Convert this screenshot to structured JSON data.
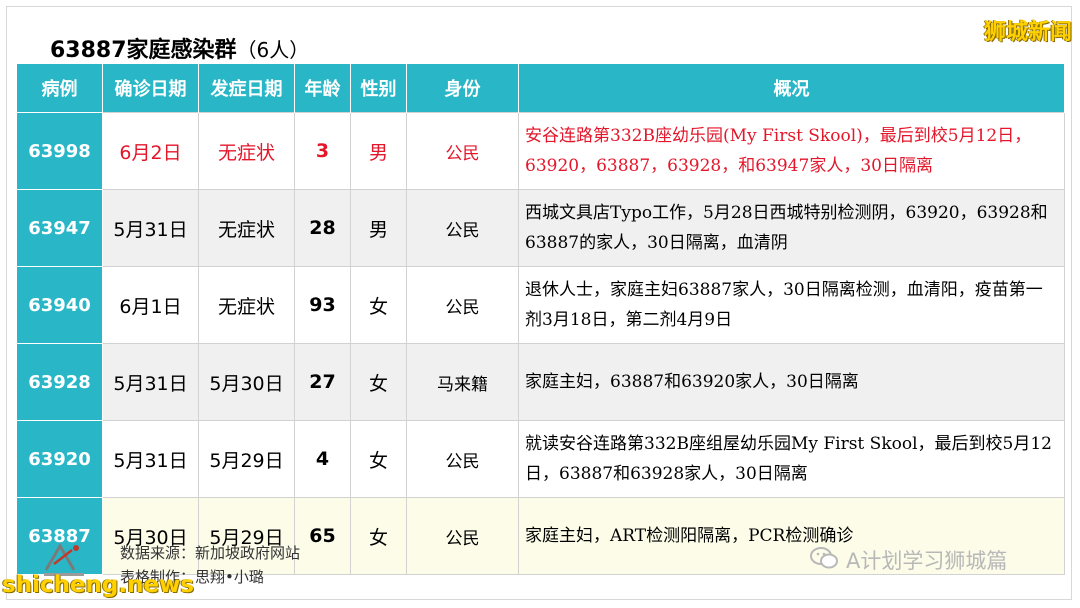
{
  "brand": "狮城新闻",
  "title": {
    "main": "63887家庭感染群",
    "count": "（6人）"
  },
  "table": {
    "headers": [
      "病例",
      "确诊日期",
      "发症日期",
      "年龄",
      "性别",
      "身份",
      "概况"
    ],
    "rows": [
      {
        "case": "63998",
        "confirmed": "6月2日",
        "onset": "无症状",
        "age": "3",
        "sex": "男",
        "status": "公民",
        "summary": "安谷连路第332B座幼乐园(My First Skool)，最后到校5月12日，63920，63887，63928，和63947家人，30日隔离"
      },
      {
        "case": "63947",
        "confirmed": "5月31日",
        "onset": "无症状",
        "age": "28",
        "sex": "男",
        "status": "公民",
        "summary": "西城文具店Typo工作，5月28日西城特别检测阴，63920，63928和63887的家人，30日隔离，血清阴"
      },
      {
        "case": "63940",
        "confirmed": "6月1日",
        "onset": "无症状",
        "age": "93",
        "sex": "女",
        "status": "公民",
        "summary": "退休人士，家庭主妇63887家人，30日隔离检测，血清阳，疫苗第一剂3月18日，第二剂4月9日"
      },
      {
        "case": "63928",
        "confirmed": "5月31日",
        "onset": "5月30日",
        "age": "27",
        "sex": "女",
        "status": "马来籍",
        "summary": "家庭主妇，63887和63920家人，30日隔离"
      },
      {
        "case": "63920",
        "confirmed": "5月31日",
        "onset": "5月29日",
        "age": "4",
        "sex": "女",
        "status": "公民",
        "summary": "就读安谷连路第332B座组屋幼乐园My First Skool，最后到校5月12日，63887和63928家人，30日隔离"
      },
      {
        "case": "63887",
        "confirmed": "5月30日",
        "onset": "5月29日",
        "age": "65",
        "sex": "女",
        "status": "公民",
        "summary": "家庭主妇，ART检测阳隔离，PCR检测确诊"
      }
    ]
  },
  "footer": {
    "source": "数据来源：新加坡政府网站",
    "maker": "表格制作：思翔•小璐",
    "wechat": "A计划学习狮城篇",
    "watermark": "shicheng.news"
  },
  "colors": {
    "header": "#29b7c8",
    "highlight": "#e3162a",
    "brand": "#ffd100"
  },
  "icons": {
    "logo": "a-plan-logo-icon",
    "wechat": "wechat-icon"
  }
}
